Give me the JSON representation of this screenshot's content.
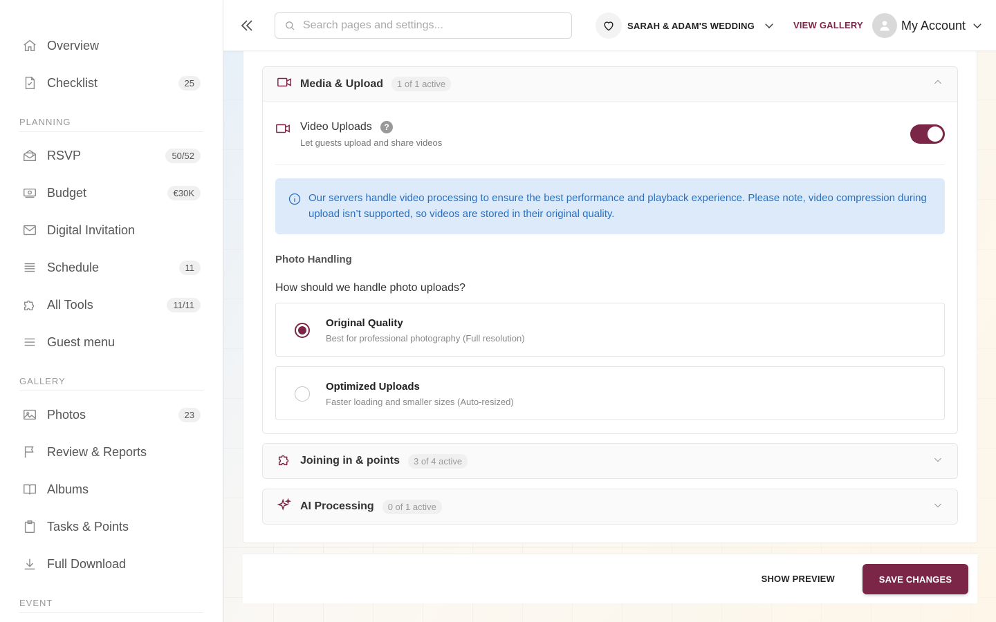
{
  "sidebar": {
    "items": [
      {
        "label": "Overview",
        "icon": "home-icon"
      },
      {
        "label": "Checklist",
        "icon": "checklist-icon",
        "badge": "25"
      },
      {
        "label": "RSVP",
        "icon": "envelope-open-icon",
        "badge": "50/52"
      },
      {
        "label": "Budget",
        "icon": "money-icon",
        "badge": "€30K"
      },
      {
        "label": "Digital Invitation",
        "icon": "mail-icon"
      },
      {
        "label": "Schedule",
        "icon": "list-icon",
        "badge": "11"
      },
      {
        "label": "All Tools",
        "icon": "puzzle-icon",
        "badge": "11/11"
      },
      {
        "label": "Guest menu",
        "icon": "menu-icon"
      },
      {
        "label": "Photos",
        "icon": "image-icon",
        "badge": "23"
      },
      {
        "label": "Review & Reports",
        "icon": "flag-icon"
      },
      {
        "label": "Albums",
        "icon": "book-icon"
      },
      {
        "label": "Tasks & Points",
        "icon": "clipboard-icon"
      },
      {
        "label": "Full Download",
        "icon": "download-icon"
      }
    ],
    "sections": {
      "planning": "PLANNING",
      "gallery": "GALLERY",
      "event": "EVENT"
    }
  },
  "header": {
    "search_placeholder": "Search pages and settings...",
    "search_value": "",
    "event_name": "SARAH & ADAM'S WEDDING",
    "view_gallery": "VIEW GALLERY",
    "account": "My Account"
  },
  "media": {
    "title": "Media & Upload",
    "count": "1 of 1 active",
    "video": {
      "title": "Video Uploads",
      "help": "?",
      "description": "Let guests upload and share videos",
      "enabled": true
    },
    "info": "Our servers handle video processing to ensure the best performance and playback experience. Please note, video compression during upload isn’t supported, so videos are stored in their original quality.",
    "photo_handling": {
      "title": "Photo Handling",
      "question": "How should we handle photo uploads?",
      "options": [
        {
          "title": "Original Quality",
          "description": "Best for professional photography (Full resolution)",
          "selected": true
        },
        {
          "title": "Optimized Uploads",
          "description": "Faster loading and smaller sizes (Auto-resized)",
          "selected": false
        }
      ]
    }
  },
  "joining": {
    "title": "Joining in & points",
    "count": "3 of 4 active"
  },
  "ai": {
    "title": "AI Processing",
    "count": "0 of 1 active"
  },
  "footer": {
    "preview": "SHOW PREVIEW",
    "save": "SAVE CHANGES"
  },
  "colors": {
    "accent": "#7b2646",
    "info_bg": "#dceaf9",
    "info_text": "#2b6fc0"
  }
}
